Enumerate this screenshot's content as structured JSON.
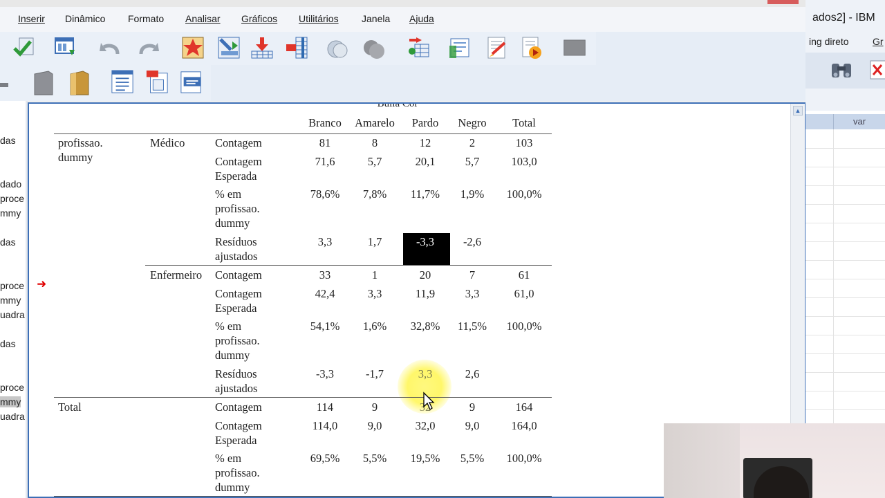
{
  "viewer": {
    "menu": [
      "Inserir",
      "Dinâmico",
      "Formato",
      "Analisar",
      "Gráficos",
      "Utilitários",
      "Janela",
      "Ajuda"
    ],
    "left_pane": [
      "das",
      "dado",
      "proce",
      "mmy",
      "das",
      "proce",
      "mmy",
      "uadra",
      "das",
      "proce",
      "mmy",
      "uadra"
    ]
  },
  "data_editor": {
    "title_fragment": "ados2] - IBM",
    "menu": [
      "ing direto",
      "Gr"
    ],
    "column_header": "var"
  },
  "crosstab": {
    "spanning_header": "Bulla Cor",
    "columns": [
      "Branco",
      "Amarelo",
      "Pardo",
      "Negro",
      "Total"
    ],
    "row_var_line1": "profissao.",
    "row_var_line2": "dummy",
    "groups": [
      {
        "label": "Médico",
        "rows": [
          {
            "stat": [
              "Contagem"
            ],
            "values": [
              "81",
              "8",
              "12",
              "2",
              "103"
            ]
          },
          {
            "stat": [
              "Contagem",
              "Esperada"
            ],
            "values": [
              "71,6",
              "5,7",
              "20,1",
              "5,7",
              "103,0"
            ]
          },
          {
            "stat": [
              "% em",
              "profissao.",
              "dummy"
            ],
            "values": [
              "78,6%",
              "7,8%",
              "11,7%",
              "1,9%",
              "100,0%"
            ]
          },
          {
            "stat": [
              "Resíduos",
              "ajustados"
            ],
            "values": [
              "3,3",
              "1,7",
              "-3,3",
              "-2,6",
              ""
            ]
          }
        ]
      },
      {
        "label": "Enfermeiro",
        "rows": [
          {
            "stat": [
              "Contagem"
            ],
            "values": [
              "33",
              "1",
              "20",
              "7",
              "61"
            ]
          },
          {
            "stat": [
              "Contagem",
              "Esperada"
            ],
            "values": [
              "42,4",
              "3,3",
              "11,9",
              "3,3",
              "61,0"
            ]
          },
          {
            "stat": [
              "% em",
              "profissao.",
              "dummy"
            ],
            "values": [
              "54,1%",
              "1,6%",
              "32,8%",
              "11,5%",
              "100,0%"
            ]
          },
          {
            "stat": [
              "Resíduos",
              "ajustados"
            ],
            "values": [
              "-3,3",
              "-1,7",
              "3,3",
              "2,6",
              ""
            ]
          }
        ]
      }
    ],
    "total": {
      "label": "Total",
      "rows": [
        {
          "stat": [
            "Contagem"
          ],
          "values": [
            "114",
            "9",
            "32",
            "9",
            "164"
          ]
        },
        {
          "stat": [
            "Contagem",
            "Esperada"
          ],
          "values": [
            "114,0",
            "9,0",
            "32,0",
            "9,0",
            "164,0"
          ]
        },
        {
          "stat": [
            "% em",
            "profissao.",
            "dummy"
          ],
          "values": [
            "69,5%",
            "5,5%",
            "19,5%",
            "5,5%",
            "100,0%"
          ]
        }
      ]
    }
  }
}
